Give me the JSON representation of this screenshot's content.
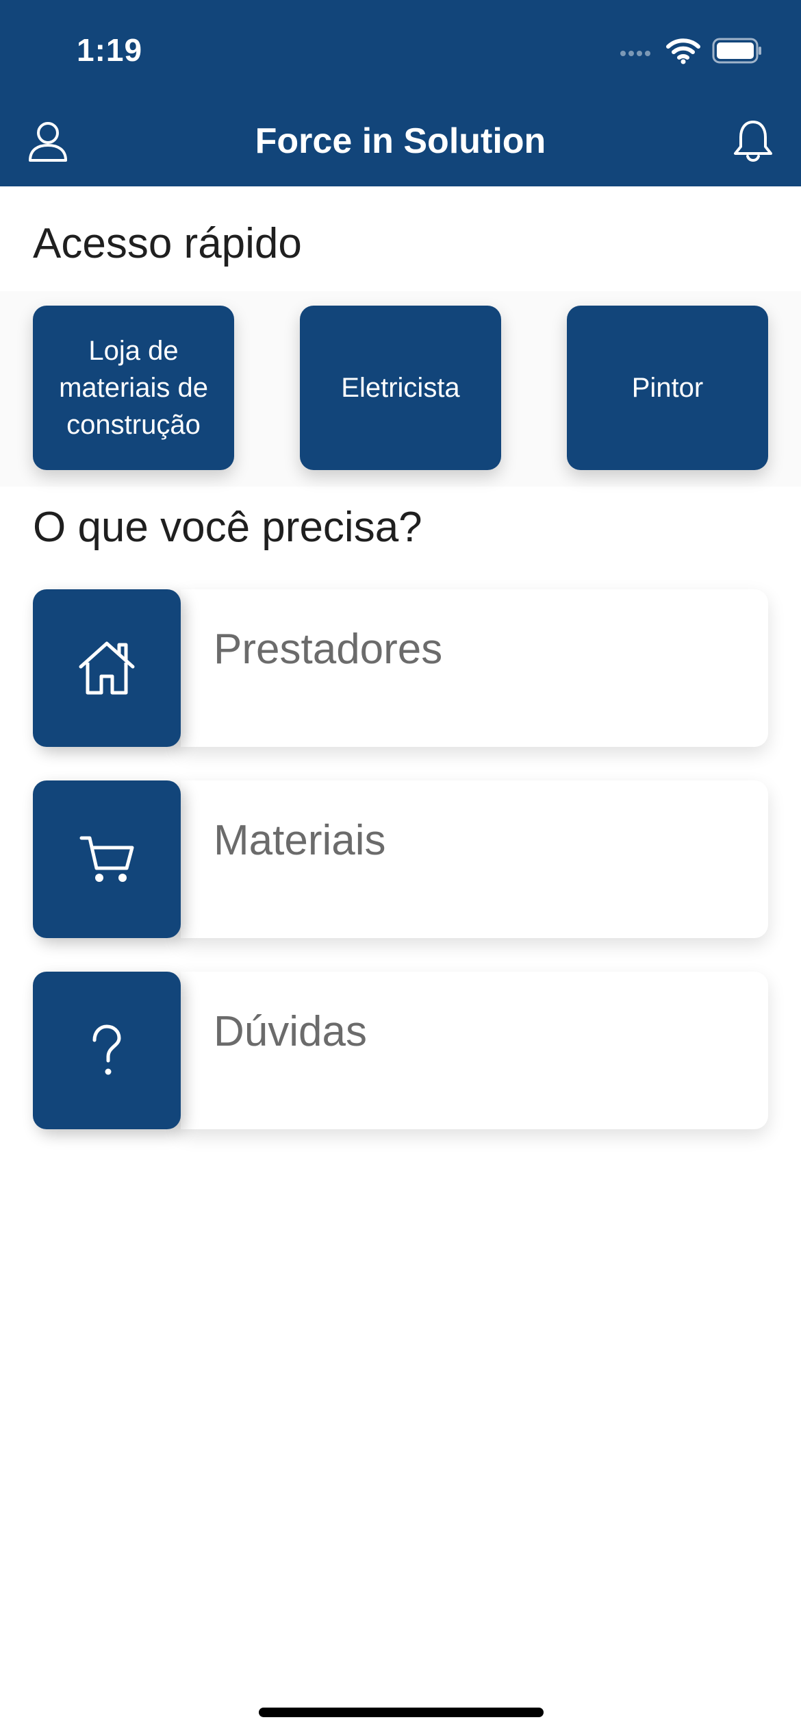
{
  "status_bar": {
    "time": "1:19"
  },
  "header": {
    "title": "Force in Solution",
    "left_icon": "user-icon",
    "right_icon": "bell-icon"
  },
  "quick_access": {
    "title": "Acesso rápido",
    "items": [
      {
        "label": "Loja de materiais de construção"
      },
      {
        "label": "Eletricista"
      },
      {
        "label": "Pintor"
      }
    ]
  },
  "needs": {
    "title": "O que você precisa?",
    "items": [
      {
        "label": "Prestadores",
        "icon": "home-icon"
      },
      {
        "label": "Materiais",
        "icon": "cart-icon"
      },
      {
        "label": "Dúvidas",
        "icon": "question-icon"
      }
    ]
  },
  "colors": {
    "primary": "#12457a",
    "text_dark": "#1f1f1f",
    "text_muted": "#6b6b6b"
  }
}
